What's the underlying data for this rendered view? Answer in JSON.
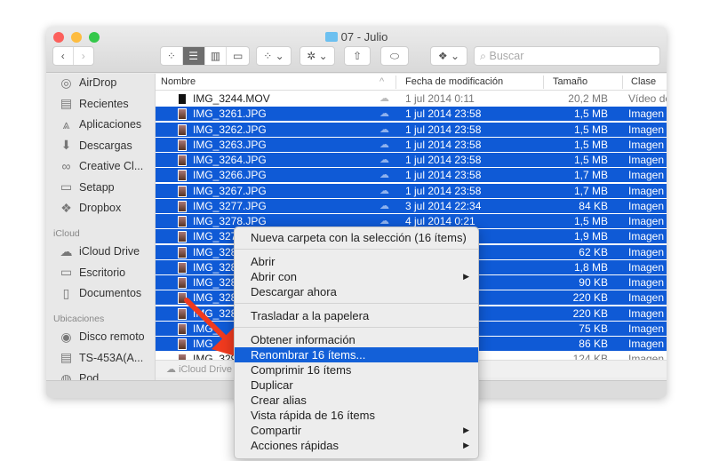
{
  "window": {
    "title": "07 - Julio"
  },
  "toolbar": {
    "search_placeholder": "Buscar"
  },
  "sidebar": {
    "favorites": [
      {
        "label": "AirDrop",
        "icon": "airdrop-icon"
      },
      {
        "label": "Recientes",
        "icon": "recents-icon"
      },
      {
        "label": "Aplicaciones",
        "icon": "applications-icon"
      },
      {
        "label": "Descargas",
        "icon": "downloads-icon"
      },
      {
        "label": "Creative Cl...",
        "icon": "creative-cloud-icon"
      },
      {
        "label": "Setapp",
        "icon": "folder-icon"
      },
      {
        "label": "Dropbox",
        "icon": "dropbox-icon"
      }
    ],
    "icloud_header": "iCloud",
    "icloud": [
      {
        "label": "iCloud Drive",
        "icon": "cloud-icon"
      },
      {
        "label": "Escritorio",
        "icon": "desktop-icon"
      },
      {
        "label": "Documentos",
        "icon": "documents-icon"
      }
    ],
    "locations_header": "Ubicaciones",
    "locations": [
      {
        "label": "Disco remoto",
        "icon": "disc-icon"
      },
      {
        "label": "TS-453A(A...",
        "icon": "nas-icon"
      },
      {
        "label": "Pod",
        "icon": "pod-icon"
      }
    ]
  },
  "columns": {
    "name": "Nombre",
    "date": "Fecha de modificación",
    "size": "Tamaño",
    "kind": "Clase"
  },
  "files": [
    {
      "name": "IMG_3244.MOV",
      "date": "1 jul 2014 0:11",
      "size": "20,2 MB",
      "kind": "Vídeo de",
      "selected": false
    },
    {
      "name": "IMG_3261.JPG",
      "date": "1 jul 2014 23:58",
      "size": "1,5 MB",
      "kind": "Imagen",
      "selected": true
    },
    {
      "name": "IMG_3262.JPG",
      "date": "1 jul 2014 23:58",
      "size": "1,5 MB",
      "kind": "Imagen",
      "selected": true
    },
    {
      "name": "IMG_3263.JPG",
      "date": "1 jul 2014 23:58",
      "size": "1,5 MB",
      "kind": "Imagen",
      "selected": true
    },
    {
      "name": "IMG_3264.JPG",
      "date": "1 jul 2014 23:58",
      "size": "1,5 MB",
      "kind": "Imagen",
      "selected": true
    },
    {
      "name": "IMG_3266.JPG",
      "date": "1 jul 2014 23:58",
      "size": "1,7 MB",
      "kind": "Imagen",
      "selected": true
    },
    {
      "name": "IMG_3267.JPG",
      "date": "1 jul 2014 23:58",
      "size": "1,7 MB",
      "kind": "Imagen",
      "selected": true
    },
    {
      "name": "IMG_3277.JPG",
      "date": "3 jul 2014 22:34",
      "size": "84 KB",
      "kind": "Imagen",
      "selected": true
    },
    {
      "name": "IMG_3278.JPG",
      "date": "4 jul 2014 0:21",
      "size": "1,5 MB",
      "kind": "Imagen",
      "selected": true
    },
    {
      "name": "IMG_327",
      "date": "",
      "size": "1,9 MB",
      "kind": "Imagen",
      "selected": true
    },
    {
      "name": "IMG_328",
      "date": "",
      "size": "62 KB",
      "kind": "Imagen",
      "selected": true
    },
    {
      "name": "IMG_328",
      "date": "",
      "size": "1,8 MB",
      "kind": "Imagen",
      "selected": true
    },
    {
      "name": "IMG_328",
      "date": "",
      "size": "90 KB",
      "kind": "Imagen",
      "selected": true
    },
    {
      "name": "IMG_328",
      "date": "",
      "size": "220 KB",
      "kind": "Imagen",
      "selected": true
    },
    {
      "name": "IMG_328",
      "date": "",
      "size": "220 KB",
      "kind": "Imagen",
      "selected": true
    },
    {
      "name": "IMG_",
      "date": "",
      "size": "75 KB",
      "kind": "Imagen",
      "selected": true
    },
    {
      "name": "IMG_",
      "date": "",
      "size": "86 KB",
      "kind": "Imagen",
      "selected": true
    },
    {
      "name": "IMG_329",
      "date": "",
      "size": "124 KB",
      "kind": "Imagen",
      "selected": false
    }
  ],
  "status": {
    "path": "iCloud Drive"
  },
  "context_menu": {
    "items": [
      {
        "label": "Nueva carpeta con la selección (16 ítems)"
      },
      {
        "sep": true
      },
      {
        "label": "Abrir"
      },
      {
        "label": "Abrir con",
        "submenu": true
      },
      {
        "label": "Descargar ahora"
      },
      {
        "sep": true
      },
      {
        "label": "Trasladar a la papelera"
      },
      {
        "sep": true
      },
      {
        "label": "Obtener información"
      },
      {
        "label": "Renombrar 16 ítems...",
        "highlighted": true
      },
      {
        "label": "Comprimir 16 ítems"
      },
      {
        "label": "Duplicar"
      },
      {
        "label": "Crear alias"
      },
      {
        "label": "Vista rápida de 16 ítems"
      },
      {
        "label": "Compartir",
        "submenu": true
      },
      {
        "label": "Acciones rápidas",
        "submenu": true
      }
    ]
  },
  "colors": {
    "selection": "#0f5ad6",
    "menu_highlight": "#1360d8",
    "annotation_arrow": "#f03a1e"
  }
}
